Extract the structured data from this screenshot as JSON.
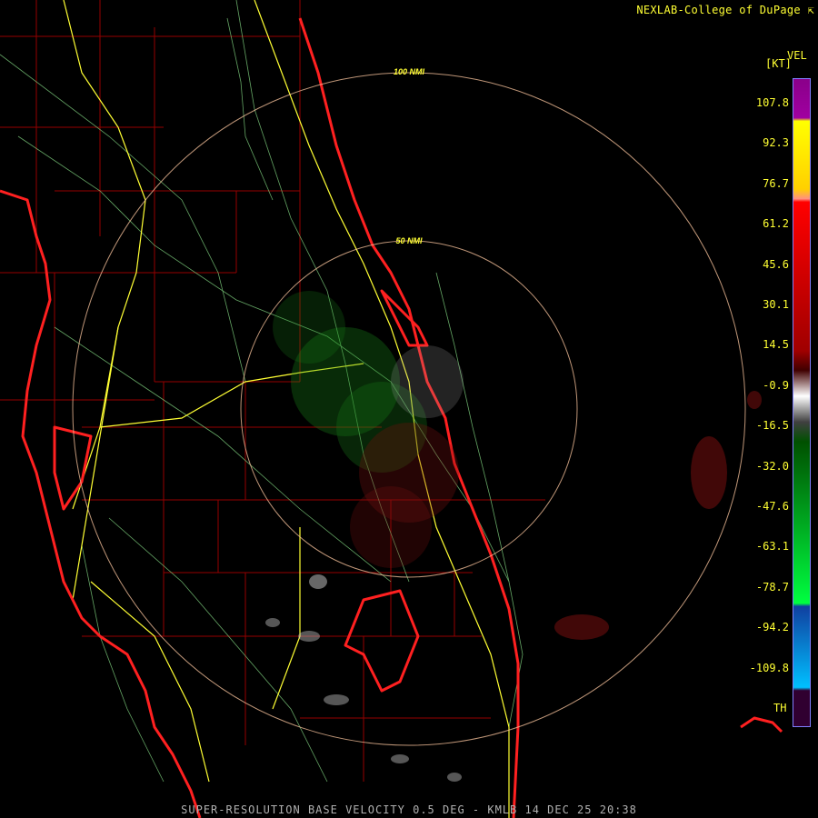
{
  "credit": "NEXLAB-College of DuPage",
  "legend": {
    "product": "VEL",
    "units": "[KT]",
    "labels": [
      "107.8",
      "92.3",
      "76.7",
      "61.2",
      "45.6",
      "30.1",
      "14.5",
      "-0.9",
      "-16.5",
      "-32.0",
      "-47.6",
      "-63.1",
      "-78.7",
      "-94.2",
      "-109.8"
    ],
    "bottom_label": "TH"
  },
  "range_rings": [
    {
      "label": "100 NMI"
    },
    {
      "label": "50 NMI"
    }
  ],
  "footer": "SUPER-RESOLUTION BASE VELOCITY 0.5 DEG - KMLB 14 DEC 25 20:38",
  "colors": {
    "background": "#000000",
    "coastline": "#ff2020",
    "county_lines": "#c00000",
    "highways": "#ffff33",
    "roads": "#80d080",
    "range_rings": "#ffd0a0",
    "ring_labels": "#ffff33"
  }
}
